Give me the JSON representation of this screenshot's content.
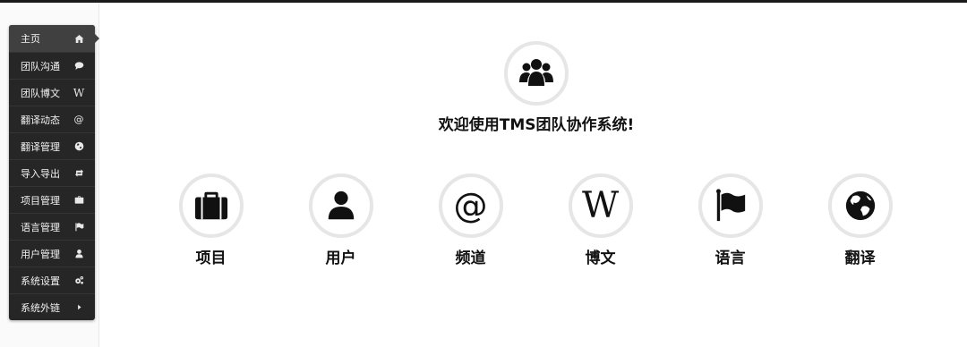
{
  "sidebar": {
    "items": [
      {
        "label": "主页",
        "icon": "home-icon"
      },
      {
        "label": "团队沟通",
        "icon": "chat-bubble-icon"
      },
      {
        "label": "团队博文",
        "icon": "wikipedia-w-icon",
        "glyph": "W"
      },
      {
        "label": "翻译动态",
        "icon": "at-sign-icon",
        "glyph": "@"
      },
      {
        "label": "翻译管理",
        "icon": "globe-icon"
      },
      {
        "label": "导入导出",
        "icon": "retweet-icon"
      },
      {
        "label": "项目管理",
        "icon": "briefcase-icon"
      },
      {
        "label": "语言管理",
        "icon": "flag-icon"
      },
      {
        "label": "用户管理",
        "icon": "user-icon"
      },
      {
        "label": "系统设置",
        "icon": "gears-icon"
      },
      {
        "label": "系统外链",
        "icon": "caret-right-icon"
      }
    ]
  },
  "welcome": {
    "icon": "users-group-icon",
    "title": "欢迎使用TMS团队协作系统!"
  },
  "tiles": [
    {
      "label": "项目",
      "icon": "briefcase-icon"
    },
    {
      "label": "用户",
      "icon": "user-icon"
    },
    {
      "label": "频道",
      "icon": "at-sign-icon",
      "glyph": "@"
    },
    {
      "label": "博文",
      "icon": "wikipedia-w-icon",
      "glyph": "W"
    },
    {
      "label": "语言",
      "icon": "flag-icon"
    },
    {
      "label": "翻译",
      "icon": "globe-icon"
    }
  ]
}
